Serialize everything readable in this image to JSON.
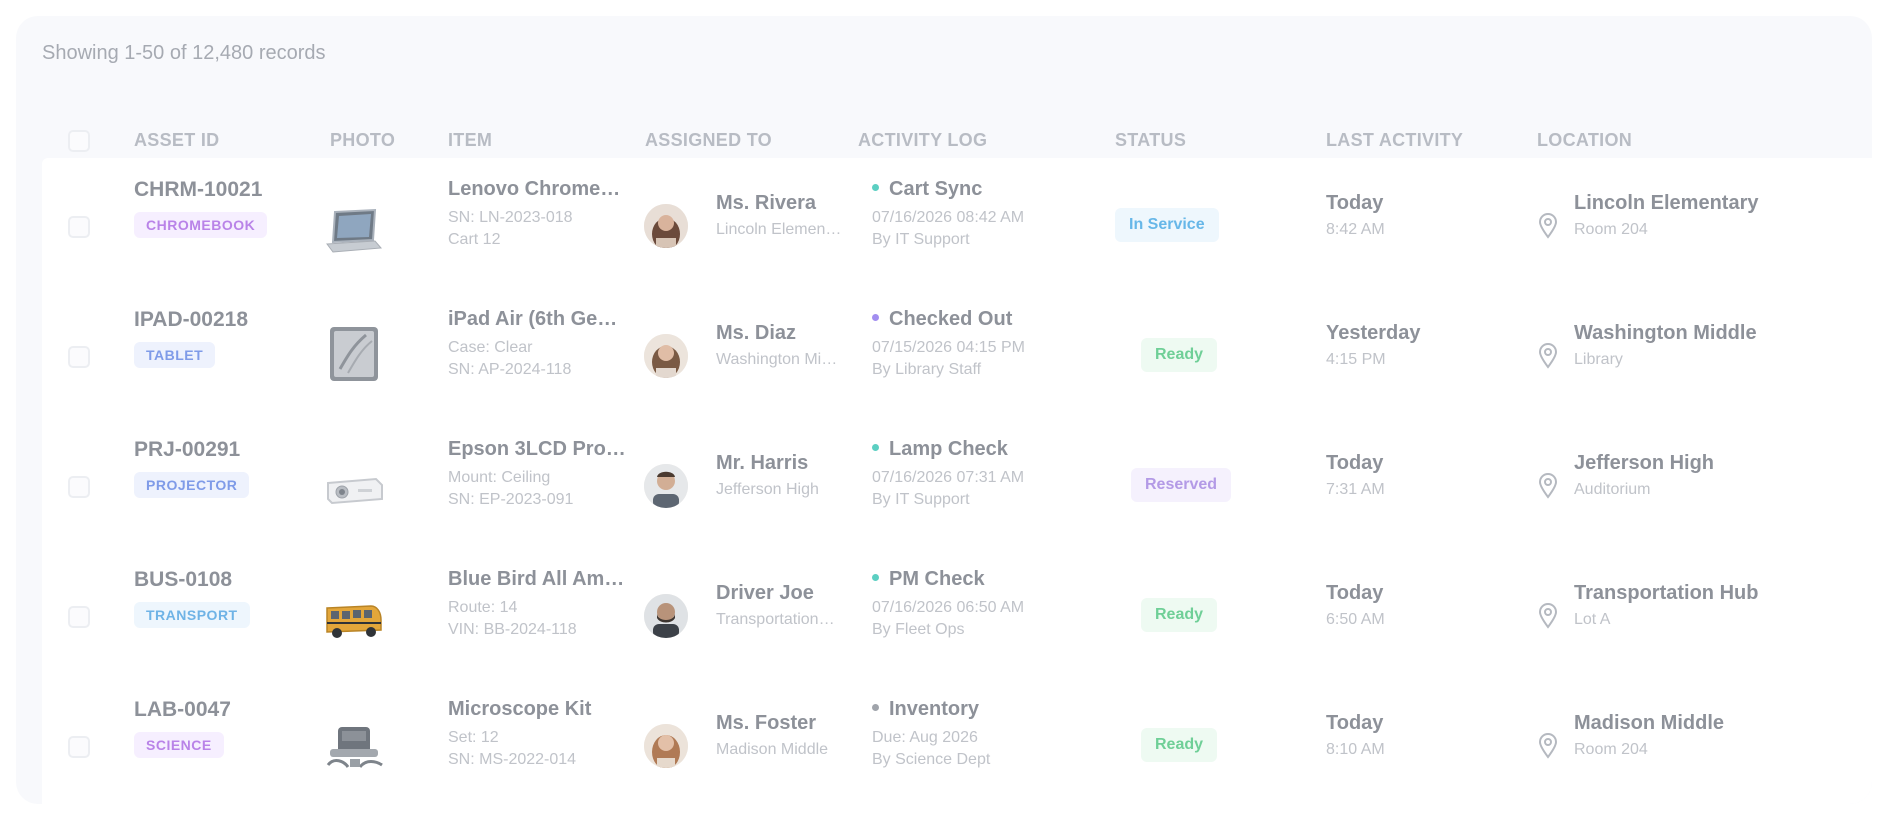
{
  "summary": "Showing 1-50 of 12,480 records",
  "columns": {
    "asset_id": "ASSET ID",
    "photo": "PHOTO",
    "item": "ITEM",
    "assigned_to": "ASSIGNED TO",
    "activity_log": "ACTIVITY LOG",
    "status": "STATUS",
    "last_activity": "LAST ACTIVITY",
    "location": "LOCATION"
  },
  "colors": {
    "tag_chromebook": "#b983e8",
    "tag_tablet": "#7f9be8",
    "tag_projector": "#7f9be8",
    "tag_transport": "#6fb3e6",
    "tag_science": "#b983e8",
    "status_in_service": "#67b7e8",
    "status_ready": "#6fcf97",
    "status_reserved": "#b39ae6",
    "dot_teal": "#5ccfc2",
    "dot_purple": "#a28ef0",
    "dot_gray": "#a0a4ab"
  },
  "rows": [
    {
      "asset_id": "CHRM-10021",
      "tag": "CHROMEBOOK",
      "photo_icon": "laptop-icon",
      "item_title": "Lenovo Chrome…",
      "item_sub1": "SN: LN-2023-018",
      "item_sub2": "Cart 12",
      "person": "Ms. Rivera",
      "person_sub": "Lincoln Elemen…",
      "activity": "Cart Sync",
      "activity_time": "07/16/2026 08:42 AM",
      "activity_by": "By IT Support",
      "status": "In Service",
      "last": "Today",
      "last_time": "8:42 AM",
      "location": "Lincoln Elementary",
      "location_sub": "Room 204"
    },
    {
      "asset_id": "IPAD-00218",
      "tag": "TABLET",
      "photo_icon": "tablet-icon",
      "item_title": "iPad Air (6th Ge…",
      "item_sub1": "Case: Clear",
      "item_sub2": "SN: AP-2024-118",
      "person": "Ms. Diaz",
      "person_sub": "Washington Mi…",
      "activity": "Checked Out",
      "activity_time": "07/15/2026 04:15 PM",
      "activity_by": "By Library Staff",
      "status": "Ready",
      "last": "Yesterday",
      "last_time": "4:15 PM",
      "location": "Washington Middle",
      "location_sub": "Library"
    },
    {
      "asset_id": "PRJ-00291",
      "tag": "PROJECTOR",
      "photo_icon": "projector-icon",
      "item_title": "Epson 3LCD Proj…",
      "item_sub1": "Mount: Ceiling",
      "item_sub2": "SN: EP-2023-091",
      "person": "Mr. Harris",
      "person_sub": "Jefferson High",
      "activity": "Lamp Check",
      "activity_time": "07/16/2026 07:31 AM",
      "activity_by": "By IT Support",
      "status": "Reserved",
      "last": "Today",
      "last_time": "7:31 AM",
      "location": "Jefferson High",
      "location_sub": "Auditorium"
    },
    {
      "asset_id": "BUS-0108",
      "tag": "TRANSPORT",
      "photo_icon": "school-bus-icon",
      "item_title": "Blue Bird All Am…",
      "item_sub1": "Route: 14",
      "item_sub2": "VIN: BB-2024-118",
      "person": "Driver Joe",
      "person_sub": "Transportation…",
      "activity": "PM Check",
      "activity_time": "07/16/2026 06:50 AM",
      "activity_by": "By Fleet Ops",
      "status": "Ready",
      "last": "Today",
      "last_time": "6:50 AM",
      "location": "Transportation Hub",
      "location_sub": "Lot A"
    },
    {
      "asset_id": "LAB-0047",
      "tag": "SCIENCE",
      "photo_icon": "microscope-kit-icon",
      "item_title": "Microscope Kit",
      "item_sub1": "Set: 12",
      "item_sub2": "SN: MS-2022-014",
      "person": "Ms. Foster",
      "person_sub": "Madison Middle",
      "activity": "Inventory",
      "activity_time": "Due: Aug 2026",
      "activity_by": "By Science Dept",
      "status": "Ready",
      "last": "Today",
      "last_time": "8:10 AM",
      "location": "Madison Middle",
      "location_sub": "Room 204"
    }
  ]
}
